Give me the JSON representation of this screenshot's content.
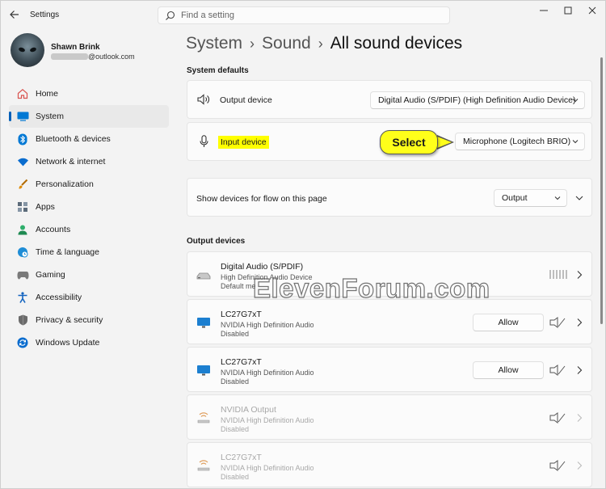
{
  "window": {
    "title": "Settings",
    "controls": [
      "minimize",
      "maximize",
      "close"
    ]
  },
  "search": {
    "placeholder": "Find a setting"
  },
  "profile": {
    "name": "Shawn Brink",
    "email_suffix": "@outlook.com"
  },
  "nav": [
    {
      "label": "Home",
      "icon": "home-icon",
      "color": "#d9534f"
    },
    {
      "label": "System",
      "icon": "system-icon",
      "color": "#0078d4",
      "active": true
    },
    {
      "label": "Bluetooth & devices",
      "icon": "bluetooth-icon",
      "color": "#0078d4"
    },
    {
      "label": "Network & internet",
      "icon": "wifi-icon",
      "color": "#0a6cce"
    },
    {
      "label": "Personalization",
      "icon": "brush-icon",
      "color": "#e08a00"
    },
    {
      "label": "Apps",
      "icon": "apps-icon",
      "color": "#5c6b7a"
    },
    {
      "label": "Accounts",
      "icon": "accounts-icon",
      "color": "#2eae6b"
    },
    {
      "label": "Time & language",
      "icon": "globe-clock-icon",
      "color": "#1f8dd6"
    },
    {
      "label": "Gaming",
      "icon": "gamepad-icon",
      "color": "#7a7a7a"
    },
    {
      "label": "Accessibility",
      "icon": "accessibility-icon",
      "color": "#1565c0"
    },
    {
      "label": "Privacy & security",
      "icon": "shield-icon",
      "color": "#6b6b6b"
    },
    {
      "label": "Windows Update",
      "icon": "update-icon",
      "color": "#0a6cce"
    }
  ],
  "breadcrumb": {
    "part1": "System",
    "part2": "Sound",
    "current": "All sound devices"
  },
  "system_defaults": {
    "heading": "System defaults",
    "output": {
      "label": "Output device",
      "value": "Digital Audio (S/PDIF) (High Definition Audio Device)"
    },
    "input": {
      "label": "Input device",
      "value": "Microphone (Logitech BRIO)"
    },
    "callout": "Select",
    "flow": {
      "label": "Show devices for flow on this page",
      "value": "Output"
    }
  },
  "output_devices": {
    "heading": "Output devices",
    "allow_label": "Allow",
    "items": [
      {
        "name": "Digital Audio (S/PDIF)",
        "sub": "High Definition Audio Device",
        "status": "Default me",
        "icon": "speaker-icon",
        "dim": false,
        "allow": false
      },
      {
        "name": "LC27G7xT",
        "sub": "NVIDIA High Definition Audio",
        "status": "Disabled",
        "icon": "monitor-icon",
        "dim": false,
        "allow": true
      },
      {
        "name": "LC27G7xT",
        "sub": "NVIDIA High Definition Audio",
        "status": "Disabled",
        "icon": "monitor-icon",
        "dim": false,
        "allow": true
      },
      {
        "name": "NVIDIA Output",
        "sub": "NVIDIA High Definition Audio",
        "status": "Disabled",
        "icon": "speaker-icon",
        "dim": true,
        "allow": false
      },
      {
        "name": "LC27G7xT",
        "sub": "NVIDIA High Definition Audio",
        "status": "Disabled",
        "icon": "speaker-icon",
        "dim": true,
        "allow": false
      }
    ]
  },
  "watermark": "ElevenForum.com"
}
